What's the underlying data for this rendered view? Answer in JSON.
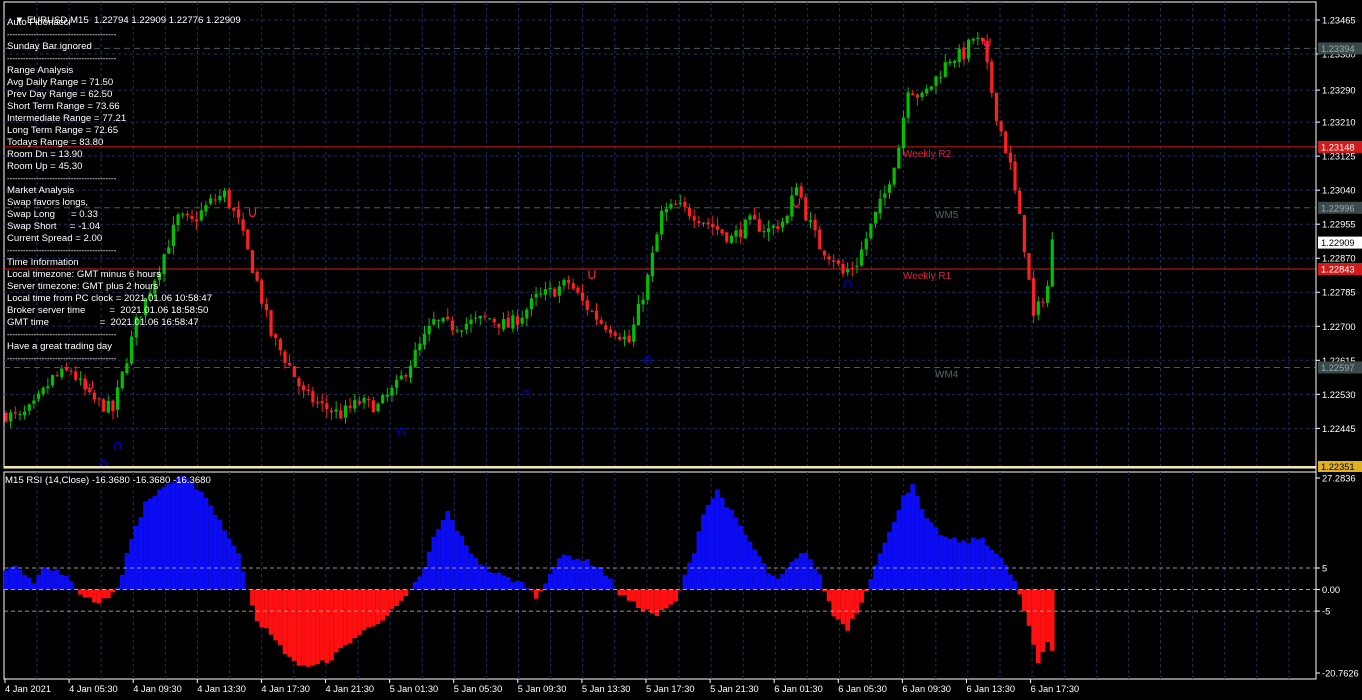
{
  "colors": {
    "bull": "#00c000",
    "bear": "#ff2020",
    "grid": "#1f2f5f",
    "axis": "#ffffff",
    "level": "#d11b1b",
    "wm": "#3f5f5f",
    "rsi_pos": "#0c0cf2",
    "rsi_neg": "#ff1010",
    "fractal_up": "#0000ff",
    "fractal_dn": "#ff1a4a",
    "separator": "#f5e6b0",
    "last_price_bg": "#ffffff",
    "bottom_price_bg": "#e0b020"
  },
  "main": {
    "header": "EURUSD,M15  1.22794 1.22909 1.22776 1.22909",
    "overlay_lines": [
      "Auto Fibonacci",
      "-----------------------------------------",
      "Sunday Bar ignored",
      "-----------------------------------------",
      "Range Analysis",
      "Avg Daily Range = 71.50",
      "Prev Day Range = 62.50",
      "Short Term Range = 73.66",
      "Intermediate Range = 77.21",
      "Long Term Range = 72.65",
      "Todays Range = 83.80",
      "Room Dn = 13.90",
      "Room Up = 45.30",
      "-----------------------------------------",
      "Market Analysis",
      "Swap favors longs,",
      "Swap Long      = 0.33",
      "Swap Short     = -1.04",
      "Current Spread = 2.00",
      "-----------------------------------------",
      "Time Information",
      "Local timezone: GMT minus 6 hours",
      "Server timezone: GMT plus 2 hours",
      "Local time from PC clock = 2021.01.06 10:58:47",
      "Broker server time         =  2021.01.06 18:58:50",
      "GMT time                   =  2021.01.06 16:58:47",
      "-----------------------------------------",
      "Have a great trading day",
      "-----------------------------------------"
    ]
  },
  "rsi": {
    "header": "M15 RSI (14,Close) -16.3680 -16.3680 -16.3680"
  },
  "chart_data": [
    {
      "type": "candlestick",
      "symbol": "EURUSD",
      "timeframe": "M15",
      "ylim": [
        1.22351,
        1.235
      ],
      "y_ticks": [
        "1.23465",
        "1.23380",
        "1.23290",
        "1.23210",
        "1.23125",
        "1.23040",
        "1.22955",
        "1.22870",
        "1.22785",
        "1.22700",
        "1.22615",
        "1.22530",
        "1.22445"
      ],
      "x_ticks": [
        "4 Jan 2021",
        "4 Jan 05:30",
        "4 Jan 09:30",
        "4 Jan 13:30",
        "4 Jan 17:30",
        "4 Jan 21:30",
        "5 Jan 01:30",
        "5 Jan 05:30",
        "5 Jan 09:30",
        "5 Jan 13:30",
        "5 Jan 17:30",
        "5 Jan 21:30",
        "6 Jan 01:30",
        "6 Jan 05:30",
        "6 Jan 09:30",
        "6 Jan 13:30",
        "6 Jan 17:30"
      ],
      "close_path": [
        [
          0,
          1.2248
        ],
        [
          3,
          1.2247
        ],
        [
          6,
          1.225
        ],
        [
          10,
          1.2257
        ],
        [
          14,
          1.2259
        ],
        [
          18,
          1.2252
        ],
        [
          23,
          1.2249
        ],
        [
          28,
          1.2271
        ],
        [
          33,
          1.2285
        ],
        [
          37,
          1.2297
        ],
        [
          40,
          1.2296
        ],
        [
          44,
          1.2301
        ],
        [
          47,
          1.2303
        ],
        [
          50,
          1.2296
        ],
        [
          54,
          1.2281
        ],
        [
          57,
          1.2268
        ],
        [
          61,
          1.226
        ],
        [
          64,
          1.2253
        ],
        [
          68,
          1.225
        ],
        [
          72,
          1.2248
        ],
        [
          76,
          1.2251
        ],
        [
          80,
          1.225
        ],
        [
          84,
          1.2255
        ],
        [
          88,
          1.2263
        ],
        [
          92,
          1.2271
        ],
        [
          96,
          1.227
        ],
        [
          100,
          1.2271
        ],
        [
          104,
          1.2272
        ],
        [
          108,
          1.227
        ],
        [
          111,
          1.2273
        ],
        [
          114,
          1.2277
        ],
        [
          118,
          1.2279
        ],
        [
          121,
          1.2281
        ],
        [
          124,
          1.2276
        ],
        [
          128,
          1.2271
        ],
        [
          131,
          1.2269
        ],
        [
          134,
          1.2266
        ],
        [
          138,
          1.2282
        ],
        [
          141,
          1.2298
        ],
        [
          144,
          1.23
        ],
        [
          148,
          1.2298
        ],
        [
          152,
          1.2295
        ],
        [
          156,
          1.2292
        ],
        [
          160,
          1.2296
        ],
        [
          164,
          1.2294
        ],
        [
          168,
          1.2297
        ],
        [
          170,
          1.2306
        ],
        [
          172,
          1.2298
        ],
        [
          175,
          1.229
        ],
        [
          178,
          1.2287
        ],
        [
          180,
          1.2283
        ],
        [
          183,
          1.2286
        ],
        [
          186,
          1.2295
        ],
        [
          189,
          1.2303
        ],
        [
          192,
          1.2315
        ],
        [
          194,
          1.233
        ],
        [
          197,
          1.2327
        ],
        [
          200,
          1.2332
        ],
        [
          203,
          1.2337
        ],
        [
          206,
          1.2338
        ],
        [
          208,
          1.2342
        ],
        [
          210,
          1.234
        ],
        [
          213,
          1.2323
        ],
        [
          216,
          1.231
        ],
        [
          219,
          1.229
        ],
        [
          221,
          1.2272
        ],
        [
          224,
          1.228
        ],
        [
          225,
          1.22909
        ]
      ],
      "horizontal_levels": [
        {
          "label": "Weekly R2",
          "value": 1.23148,
          "tag": "1.23148"
        },
        {
          "label": "Weekly R1",
          "value": 1.22843,
          "tag": "1.22843"
        },
        {
          "label": "WM5",
          "value": 1.22996,
          "tag": "1.22996"
        },
        {
          "label": "WM4",
          "value": 1.22597,
          "tag": "1.22597"
        },
        {
          "label": "",
          "value": 1.23394,
          "tag": "1.23394"
        }
      ],
      "last_price": "1.22909",
      "bottom_price": "1.22351",
      "level_labels": [
        "Weekly R2",
        "Weekly R1",
        "WM5",
        "WM4"
      ]
    },
    {
      "type": "histogram",
      "indicator": "RSI",
      "period": 14,
      "applied_to": "Close",
      "current_value": -16.368,
      "ylim": [
        -20.7626,
        27.2836
      ],
      "y_ticks": [
        "27.2836",
        "5",
        "0.00",
        "-5",
        "-20.7626"
      ],
      "levels": [
        5,
        0,
        -5
      ],
      "values": [
        [
          0,
          5
        ],
        [
          3,
          5
        ],
        [
          6,
          2
        ],
        [
          8,
          5
        ],
        [
          12,
          4
        ],
        [
          16,
          -1
        ],
        [
          20,
          -3
        ],
        [
          24,
          0
        ],
        [
          27,
          12
        ],
        [
          30,
          20
        ],
        [
          34,
          24
        ],
        [
          38,
          26
        ],
        [
          42,
          23
        ],
        [
          46,
          16
        ],
        [
          50,
          8
        ],
        [
          54,
          -7
        ],
        [
          58,
          -12
        ],
        [
          62,
          -17
        ],
        [
          66,
          -18
        ],
        [
          70,
          -16
        ],
        [
          74,
          -12
        ],
        [
          78,
          -9
        ],
        [
          82,
          -6
        ],
        [
          86,
          -2
        ],
        [
          90,
          5
        ],
        [
          92,
          12
        ],
        [
          95,
          18
        ],
        [
          99,
          10
        ],
        [
          103,
          5
        ],
        [
          107,
          3
        ],
        [
          112,
          1
        ],
        [
          114,
          -2
        ],
        [
          117,
          4
        ],
        [
          120,
          8
        ],
        [
          124,
          7
        ],
        [
          128,
          5
        ],
        [
          132,
          -1
        ],
        [
          136,
          -4
        ],
        [
          140,
          -6
        ],
        [
          144,
          -3
        ],
        [
          148,
          9
        ],
        [
          150,
          18
        ],
        [
          153,
          23
        ],
        [
          156,
          18
        ],
        [
          160,
          11
        ],
        [
          164,
          4
        ],
        [
          166,
          2
        ],
        [
          169,
          6
        ],
        [
          172,
          9
        ],
        [
          175,
          3
        ],
        [
          178,
          -6
        ],
        [
          181,
          -9
        ],
        [
          184,
          -3
        ],
        [
          187,
          6
        ],
        [
          190,
          13
        ],
        [
          193,
          22
        ],
        [
          195,
          24
        ],
        [
          198,
          16
        ],
        [
          202,
          12
        ],
        [
          206,
          11
        ],
        [
          210,
          12
        ],
        [
          214,
          7
        ],
        [
          217,
          2
        ],
        [
          219,
          -5
        ],
        [
          222,
          -17
        ],
        [
          224,
          -12
        ],
        [
          226,
          -16
        ]
      ]
    }
  ]
}
